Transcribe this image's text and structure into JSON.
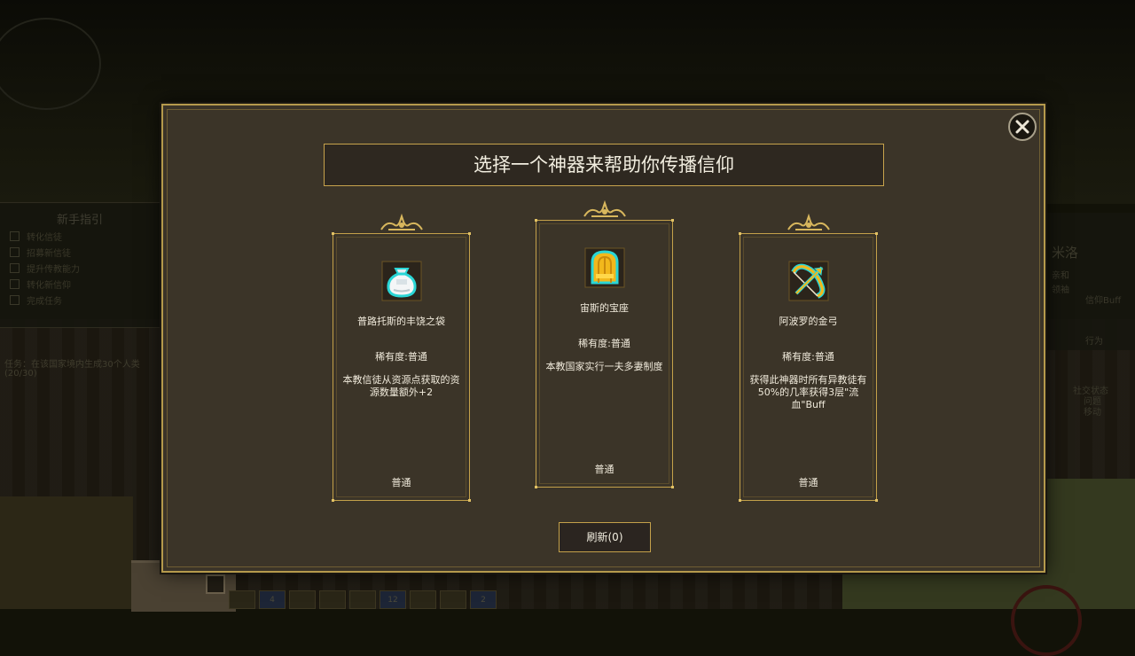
{
  "background": {
    "guide_panel": {
      "title": "新手指引",
      "items": [
        "转化信徒",
        "招募新信徒",
        "提升传教能力",
        "转化新信仰",
        "完成任务"
      ]
    },
    "event_log": [
      "任务：在该国家境内生成30个人类",
      "(20/30)"
    ],
    "info_panel": {
      "title": "米洛",
      "lines": [
        "亲和",
        "领袖",
        "信仰Buff",
        "行为",
        "社交状态",
        "问题",
        "移动"
      ]
    },
    "hotbar": [
      "",
      "4",
      "",
      "",
      "",
      "12",
      "",
      "",
      "2"
    ]
  },
  "modal": {
    "title": "选择一个神器来帮助你传播信仰",
    "refresh_label": "刷新(0)",
    "cards": [
      {
        "name": "普路托斯的丰饶之袋",
        "rarity": "稀有度:普通",
        "description": "本教信徒从资源点获取的资源数量额外+2",
        "tier": "普通",
        "icon": "money-bag-icon"
      },
      {
        "name": "宙斯的宝座",
        "rarity": "稀有度:普通",
        "description": "本教国家实行一夫多妻制度",
        "tier": "普通",
        "icon": "golden-throne-icon"
      },
      {
        "name": "阿波罗的金弓",
        "rarity": "稀有度:普通",
        "description": "获得此神器时所有异教徒有50%的几率获得3层\"流血\"Buff",
        "tier": "普通",
        "icon": "golden-bow-icon"
      }
    ]
  },
  "colors": {
    "frame_gold": "#c4a14a",
    "panel_brown": "#3b3428",
    "icon_cyan": "#2ad6d6",
    "icon_gold": "#f2b81c"
  }
}
